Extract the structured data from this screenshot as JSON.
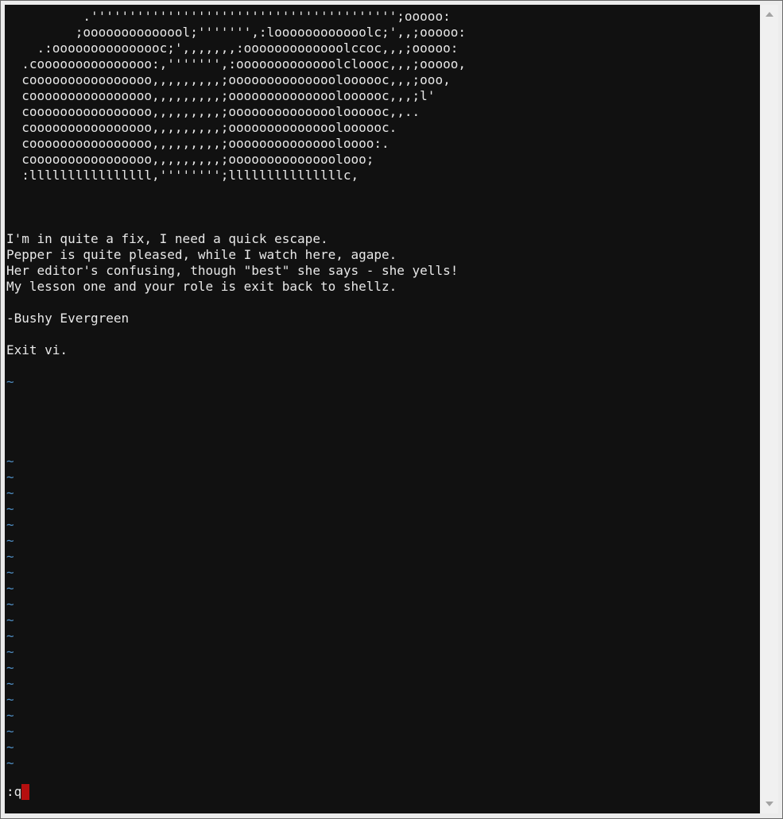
{
  "terminal": {
    "ascii_art": [
      "          .'''''''''''''''''''''''''''''''''''''''';ooooo:",
      "         ;oooooooooooool;''''''',:loooooooooooolc;',,;ooooo:",
      "    .:ooooooooooooooc;',,,,,,,:ooooooooooooolccoc,,,;ooooo:",
      "  .cooooooooooooooo:,''''''',:ooooooooooooolcloooc,,,;ooooo,",
      "  coooooooooooooooo,,,,,,,,,;ooooooooooooooloooooc,,,;ooo,",
      "  coooooooooooooooo,,,,,,,,,;ooooooooooooooloooooc,,,;l'",
      "  coooooooooooooooo,,,,,,,,,;ooooooooooooooloooooc,,..",
      "  coooooooooooooooo,,,,,,,,,;ooooooooooooooloooooc.",
      "  coooooooooooooooo,,,,,,,,,;ooooooooooooooloooo:.",
      "  coooooooooooooooo,,,,,,,,,;oooooooooooooolooo;",
      "  :llllllllllllllll,'''''''';lllllllllllllllc,"
    ],
    "poem": [
      "I'm in quite a fix, I need a quick escape.",
      "Pepper is quite pleased, while I watch here, agape.",
      "Her editor's confusing, though \"best\" she says - she yells!",
      "My lesson one and your role is exit back to shellz."
    ],
    "signature": "-Bushy Evergreen",
    "instruction": "Exit vi.",
    "tilde": "~",
    "command_line": ":q",
    "colors": {
      "background": "#111111",
      "text": "#e8e8e8",
      "tilde": "#4f8ec4",
      "cursor": "#b50f0f"
    }
  },
  "scrollbar": {
    "up_icon": "arrow-up-icon",
    "down_icon": "arrow-down-icon"
  }
}
